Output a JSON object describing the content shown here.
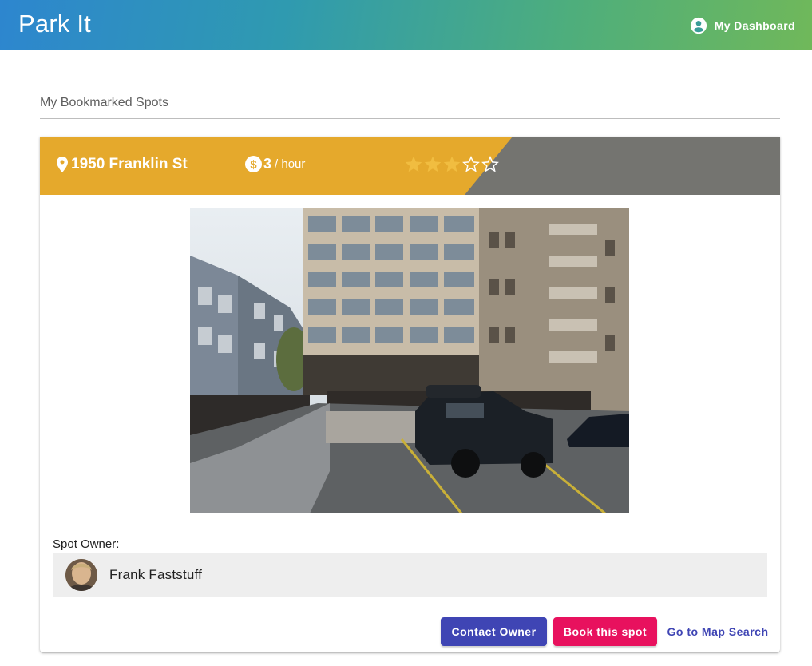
{
  "app": {
    "title": "Park It",
    "dashboard_label": "My Dashboard",
    "gradient_colors": [
      "#2d86cf",
      "#4eae7c",
      "#70b85a"
    ]
  },
  "section": {
    "title": "My Bookmarked Spots"
  },
  "spot": {
    "address": "1950 Franklin St",
    "price": "3",
    "price_unit": "/ hour",
    "rating": 3,
    "rating_max": 5,
    "banner_color": "#e5a92c",
    "banner_secondary_color": "#747470",
    "photo_icon": "parking-lot-photo"
  },
  "owner": {
    "label": "Spot Owner:",
    "name": "Frank Faststuff"
  },
  "actions": {
    "contact_label": "Contact Owner",
    "book_label": "Book this spot",
    "map_label": "Go to Map Search",
    "contact_color": "#3f45b4",
    "book_color": "#e8115e"
  }
}
